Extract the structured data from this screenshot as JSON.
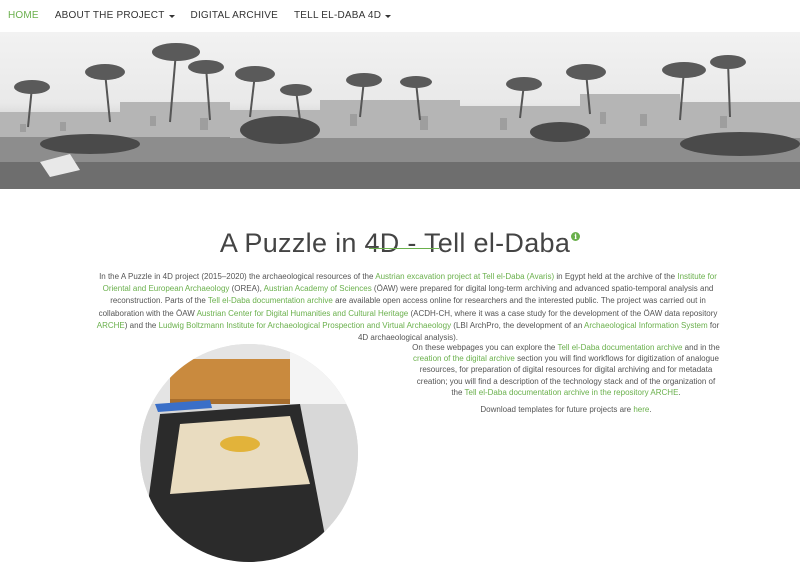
{
  "nav": {
    "items": [
      {
        "label": "HOME",
        "active": true,
        "dropdown": false
      },
      {
        "label": "ABOUT THE PROJECT",
        "active": false,
        "dropdown": true
      },
      {
        "label": "DIGITAL ARCHIVE",
        "active": false,
        "dropdown": false
      },
      {
        "label": "TELL EL-DABA 4D",
        "active": false,
        "dropdown": true
      }
    ]
  },
  "hero": {
    "icon": "village-photo"
  },
  "main": {
    "title": "A Puzzle in 4D - Tell el-Daba",
    "info_icon": "info-icon",
    "intro": {
      "t1": "In the A Puzzle in 4D project (2015–2020) the archaeological resources of the ",
      "l1": "Austrian excavation project at Tell el-Daba (Avaris)",
      "t2": " in Egypt held at the archive of the ",
      "l2": "Institute for Oriental and European Archaeology",
      "t3": " (OREA), ",
      "l3": "Austrian Academy of Sciences",
      "t4": " (ÖAW) were prepared for digital long-term archiving and advanced spatio-temporal analysis and reconstruction. Parts of the ",
      "l4": "Tell el-Daba documentation archive",
      "t5": " are available open access online for researchers and the interested public. The project was carried out in collaboration with the ÖAW ",
      "l5": "Austrian Center for Digital Humanities and Cultural Heritage",
      "t6": " (ACDH-CH, where it was a case study for the development of the ÖAW data repository ",
      "l6": "ARCHE",
      "t7": ") and the ",
      "l7": "Ludwig Boltzmann Institute for Archaeological Prospection and Virtual Archaeology",
      "t8": " (LBI ArchPro, the development of an ",
      "l8": "Archaeological Information System",
      "t9": " for 4D archaeological analysis)."
    },
    "explore": {
      "t1": "On these webpages you can explore the ",
      "l1": "Tell el-Daba documentation archive",
      "t2": " and in the ",
      "l2": "creation of the digital archive",
      "t3": " section you will find workflows for digitization of analogue resources, for preparation of digital resources for digital archiving and for metadata creation; you will find a description of the technology stack and of the organization of the ",
      "l3": "Tell el-Daba documentation archive in the repository ARCHE",
      "t4": "."
    },
    "download": {
      "t1": "Download templates for future projects are ",
      "l1": "here",
      "t2": "."
    }
  },
  "colors": {
    "accent": "#6ab04c",
    "text": "#555555"
  }
}
